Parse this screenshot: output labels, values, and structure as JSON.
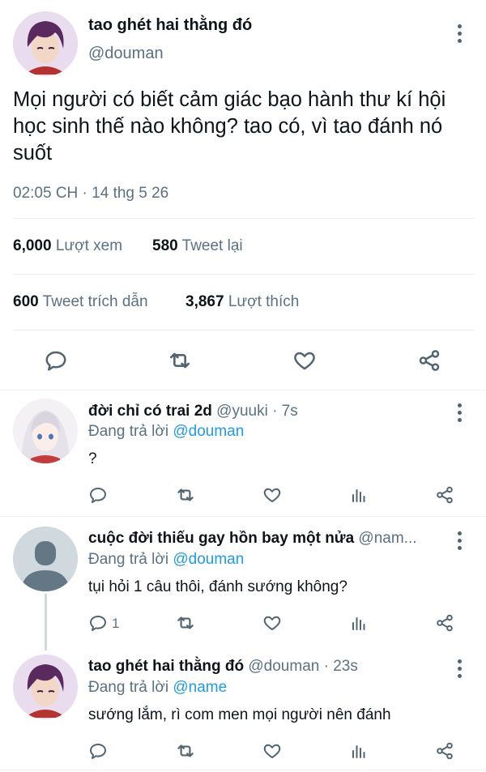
{
  "main_tweet": {
    "display_name": "tao ghét hai thằng đó",
    "handle": "@douman",
    "text": "Mọi người có biết cảm giác bạo hành thư kí hội học sinh thế nào không? tao có, vì tao đánh nó suốt",
    "timestamp": "02:05 CH · 14 thg 5 26",
    "views_count": "6,000",
    "views_label": "Lượt xem",
    "retweets_count": "580",
    "retweets_label": "Tweet lại",
    "quotes_count": "600",
    "quotes_label": "Tweet trích dẫn",
    "likes_count": "3,867",
    "likes_label": "Lượt thích"
  },
  "replies": [
    {
      "display_name": "đời chỉ có trai 2d",
      "handle_time": "@yuuki · 7s",
      "replying_prefix": "Đang trả lời",
      "replying_to": "@douman",
      "text": "?",
      "reply_count": ""
    },
    {
      "display_name": "cuộc đời thiếu gay hồn bay một nửa",
      "handle_time": "@nam...",
      "replying_prefix": "Đang trả lời",
      "replying_to": "@douman",
      "text": "tụi hỏi 1 câu thôi, đánh sướng không?",
      "reply_count": "1"
    },
    {
      "display_name": "tao ghét hai thằng đó",
      "handle_time": "@douman · 23s",
      "replying_prefix": "Đang trả lời",
      "replying_to": "@name",
      "text": "sướng lắm, rì com men mọi người nên đánh",
      "reply_count": ""
    }
  ],
  "colors": {
    "link": "#1d9bf0",
    "muted": "#5b7083",
    "divider": "#e6ecf0",
    "avatar_purple_hair": "#5a2a5e",
    "avatar_bg": "#e9dcee"
  }
}
